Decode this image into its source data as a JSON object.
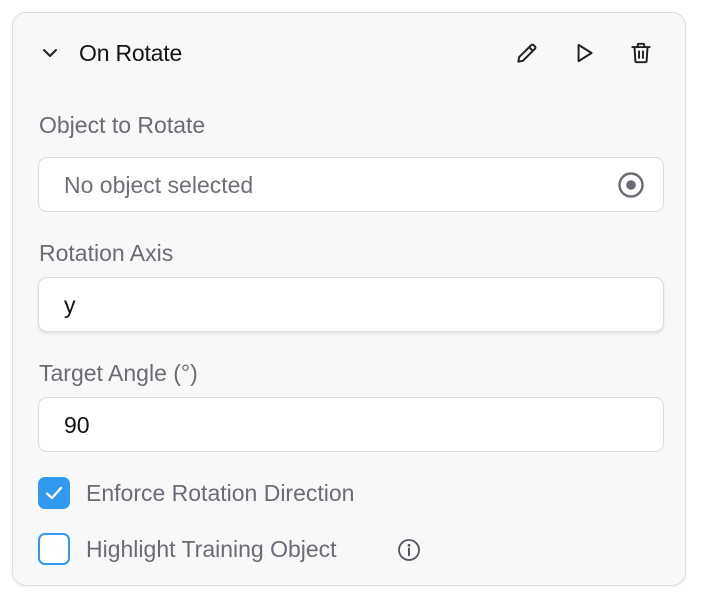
{
  "header": {
    "title": "On Rotate",
    "icons": {
      "collapse": "chevron-down-icon",
      "edit": "pencil-icon",
      "run": "play-icon",
      "delete": "trash-icon"
    }
  },
  "object_field": {
    "label": "Object to Rotate",
    "placeholder": "No object selected",
    "picker_icon": "target-icon"
  },
  "axis_field": {
    "label": "Rotation Axis",
    "value": "y"
  },
  "angle_field": {
    "label": "Target Angle (°)",
    "value": "90"
  },
  "options": [
    {
      "label": "Enforce Rotation Direction",
      "checked": true
    },
    {
      "label": "Highlight Training Object",
      "checked": false,
      "icon": "info-icon"
    }
  ],
  "colors": {
    "accent": "#2f9af0",
    "label_text": "#6b6b74",
    "card_background": "#f8f8f9"
  }
}
